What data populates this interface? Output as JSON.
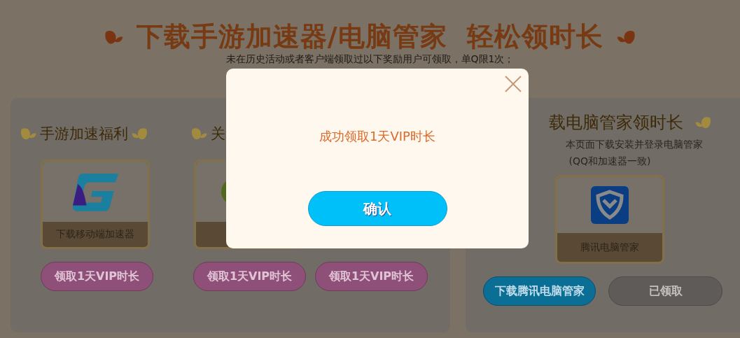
{
  "header": {
    "title": "下载手游加速器/电脑管家  轻松领时长",
    "subtitle": "未在历史活动或者客户端领取过以下奖励用户可领取，单Q限1次；"
  },
  "left_panel": {
    "sections": [
      {
        "title": "手游加速福利",
        "trailing_leaf": true,
        "cards": [
          {
            "kind": "gradient",
            "label": "下载移动端加速器"
          }
        ],
        "buttons": [
          {
            "label": "领取1天VIP时长",
            "kind": "pink"
          }
        ]
      },
      {
        "title": "关",
        "cards": [
          {
            "kind": "circle"
          }
        ],
        "buttons": [
          {
            "label": "领取1天VIP时长",
            "kind": "pink"
          },
          {
            "label": "领取1天VIP时长",
            "kind": "pink"
          }
        ]
      }
    ]
  },
  "right_panel": {
    "title": "载电脑管家领时长",
    "description": [
      "本页面下载安装并登录电脑管家",
      "(QQ和加速器一致)"
    ],
    "card": {
      "kind": "badge",
      "label": "腾讯电脑管家"
    },
    "buttons": [
      {
        "label": "下载腾讯电脑管家",
        "kind": "blue"
      },
      {
        "label": "已领取",
        "kind": "grey"
      }
    ]
  },
  "dialog": {
    "message": "成功领取1天VIP时长",
    "confirm": "确认"
  }
}
